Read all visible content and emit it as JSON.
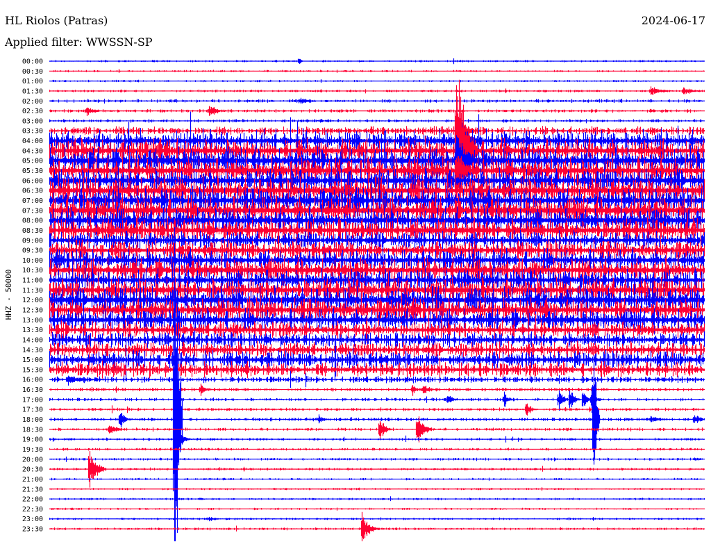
{
  "header": {
    "station": "HL Riolos (Patras)",
    "filter": "Applied filter: WWSSN-SP",
    "date": "2024-06-17"
  },
  "chart_data": {
    "type": "line",
    "title": "HL Riolos (Patras)",
    "subtitle": "Applied filter: WWSSN-SP",
    "ylabel": "HHZ - 50000",
    "minutes_per_line": 30,
    "colors": [
      "#0000ff",
      "#ff0033"
    ],
    "row_labels": [
      "00:00",
      "00:30",
      "01:00",
      "01:30",
      "02:00",
      "02:30",
      "03:00",
      "03:30",
      "04:00",
      "04:30",
      "05:00",
      "05:30",
      "06:00",
      "06:30",
      "07:00",
      "07:30",
      "08:00",
      "08:30",
      "09:00",
      "09:30",
      "10:00",
      "10:30",
      "11:00",
      "11:30",
      "12:00",
      "12:30",
      "13:00",
      "13:30",
      "14:00",
      "14:30",
      "15:00",
      "15:30",
      "16:00",
      "16:30",
      "17:00",
      "17:30",
      "18:00",
      "18:30",
      "19:00",
      "19:30",
      "20:00",
      "20:30",
      "21:00",
      "21:30",
      "22:00",
      "22:30",
      "23:00",
      "23:30"
    ],
    "relative_noise_amplitude": [
      1,
      1,
      1,
      1.2,
      1.6,
      1.6,
      1.5,
      4,
      10,
      11,
      12,
      12,
      11,
      12,
      12,
      13,
      12,
      11,
      8,
      9,
      10,
      11,
      10,
      11,
      12,
      11,
      10,
      8,
      7,
      7,
      8,
      7,
      3,
      1.6,
      1.5,
      1.4,
      1.6,
      1.4,
      1.3,
      1.2,
      1.2,
      1.2,
      1,
      1,
      1,
      1,
      1,
      1.2
    ],
    "events": [
      {
        "row": 0,
        "minute": 11.4,
        "amp": 8,
        "dur": 0.3
      },
      {
        "row": 4,
        "minute": 11.4,
        "amp": 6,
        "dur": 1.5
      },
      {
        "row": 5,
        "minute": 7.3,
        "amp": 10,
        "dur": 1.2
      },
      {
        "row": 5,
        "minute": 1.7,
        "amp": 8,
        "dur": 1.0
      },
      {
        "row": 3,
        "minute": 27.5,
        "amp": 8,
        "dur": 1.5
      },
      {
        "row": 3,
        "minute": 29.0,
        "amp": 7,
        "dur": 1.5
      },
      {
        "row": 5,
        "minute": 27.5,
        "amp": 6,
        "dur": 0.5
      },
      {
        "row": 7,
        "minute": 18.6,
        "amp": 40,
        "dur": 1.0
      },
      {
        "row": 8,
        "minute": 18.6,
        "amp": 80,
        "dur": 1.0
      },
      {
        "row": 9,
        "minute": 18.6,
        "amp": 200,
        "dur": 1.0
      },
      {
        "row": 10,
        "minute": 18.6,
        "amp": 60,
        "dur": 1.2
      },
      {
        "row": 11,
        "minute": 18.6,
        "amp": 40,
        "dur": 1.2
      },
      {
        "row": 36,
        "minute": 5.7,
        "amp": 520,
        "dur": 0.4
      },
      {
        "row": 38,
        "minute": 5.9,
        "amp": 12,
        "dur": 0.8
      },
      {
        "row": 36,
        "minute": 3.2,
        "amp": 18,
        "dur": 0.6
      },
      {
        "row": 36,
        "minute": 24.9,
        "amp": 200,
        "dur": 0.3
      },
      {
        "row": 41,
        "minute": 1.8,
        "amp": 40,
        "dur": 0.8
      },
      {
        "row": 47,
        "minute": 14.3,
        "amp": 30,
        "dur": 0.8
      },
      {
        "row": 37,
        "minute": 16.8,
        "amp": 30,
        "dur": 0.8
      },
      {
        "row": 37,
        "minute": 15.1,
        "amp": 22,
        "dur": 0.6
      },
      {
        "row": 34,
        "minute": 23.3,
        "amp": 25,
        "dur": 0.5
      },
      {
        "row": 34,
        "minute": 23.8,
        "amp": 22,
        "dur": 0.5
      },
      {
        "row": 34,
        "minute": 24.4,
        "amp": 20,
        "dur": 0.5
      },
      {
        "row": 34,
        "minute": 24.8,
        "amp": 25,
        "dur": 0.5
      },
      {
        "row": 34,
        "minute": 20.8,
        "amp": 15,
        "dur": 0.5
      },
      {
        "row": 34,
        "minute": 18.2,
        "amp": 12,
        "dur": 0.6
      },
      {
        "row": 33,
        "minute": 17.1,
        "amp": 15,
        "dur": 0.6
      },
      {
        "row": 33,
        "minute": 16.6,
        "amp": 12,
        "dur": 0.5
      },
      {
        "row": 35,
        "minute": 21.8,
        "amp": 14,
        "dur": 0.6
      },
      {
        "row": 36,
        "minute": 29.5,
        "amp": 10,
        "dur": 0.8
      },
      {
        "row": 36,
        "minute": 27.5,
        "amp": 8,
        "dur": 1.2
      },
      {
        "row": 36,
        "minute": 12.3,
        "amp": 10,
        "dur": 0.5
      },
      {
        "row": 37,
        "minute": 2.7,
        "amp": 10,
        "dur": 1.0
      },
      {
        "row": 32,
        "minute": 0.8,
        "amp": 10,
        "dur": 1.5
      },
      {
        "row": 33,
        "minute": 6.9,
        "amp": 12,
        "dur": 0.6
      },
      {
        "row": 40,
        "minute": 29.5,
        "amp": 4,
        "dur": 0.8
      },
      {
        "row": 46,
        "minute": 7.3,
        "amp": 5,
        "dur": 0.8
      },
      {
        "row": 44,
        "minute": 6.9,
        "amp": 4,
        "dur": 0.4
      }
    ]
  }
}
